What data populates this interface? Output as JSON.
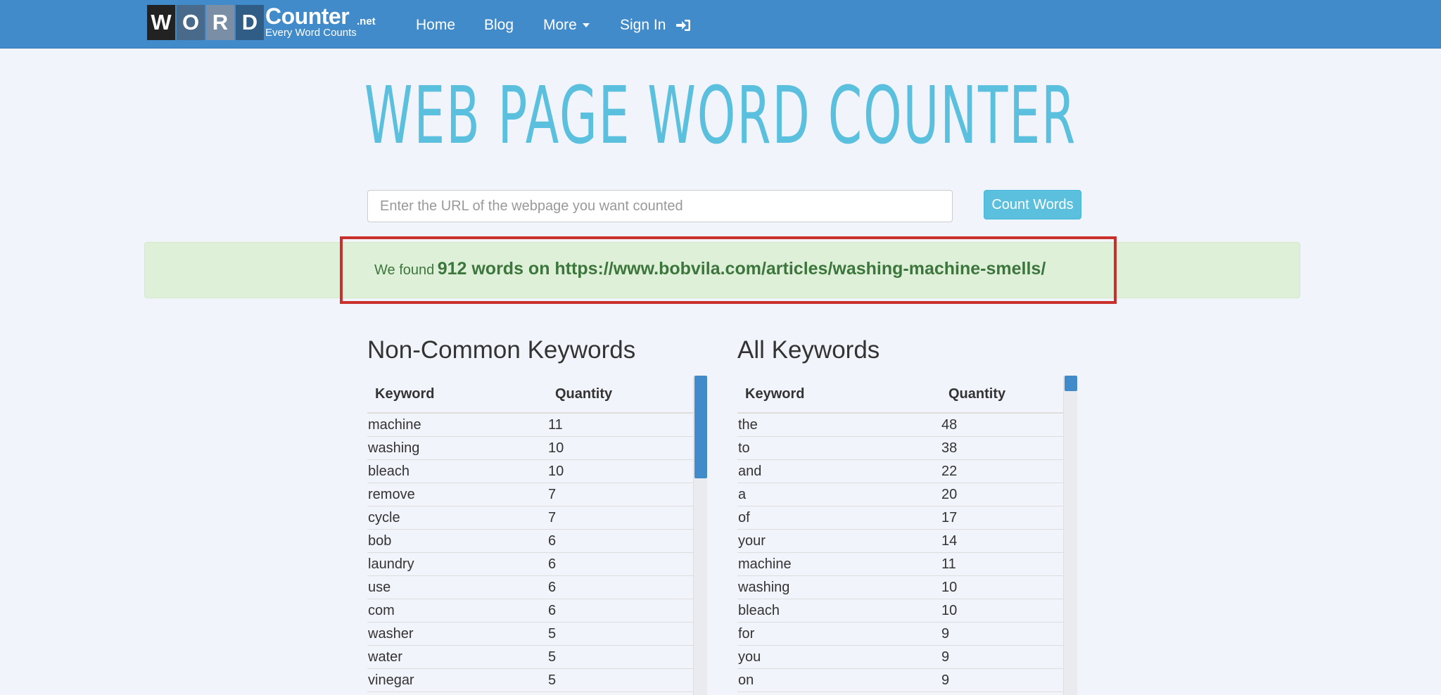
{
  "brand": {
    "letters": [
      "W",
      "O",
      "R",
      "D"
    ],
    "letter_colors": [
      "#222222",
      "#4a6a8c",
      "#7a8fa6",
      "#2f5d86"
    ],
    "name": "Counter",
    "suffix": ".net",
    "tagline": "Every Word Counts"
  },
  "nav": {
    "home": "Home",
    "blog": "Blog",
    "more": "More",
    "signin": "Sign In",
    "signin_icon": "sign-in-icon",
    "more_icon": "caret-down-icon"
  },
  "title": "WEB PAGE WORD COUNTER",
  "form": {
    "url_placeholder": "Enter the URL of the webpage you want counted",
    "url_value": "",
    "button_label": "Count Words"
  },
  "result": {
    "prefix": "We found",
    "word_count_text": "912 words on https://www.bobvila.com/articles/washing-machine-smells/"
  },
  "non_common": {
    "heading": "Non-Common Keywords",
    "col_keyword": "Keyword",
    "col_quantity": "Quantity",
    "rows": [
      {
        "keyword": "machine",
        "quantity": "11"
      },
      {
        "keyword": "washing",
        "quantity": "10"
      },
      {
        "keyword": "bleach",
        "quantity": "10"
      },
      {
        "keyword": "remove",
        "quantity": "7"
      },
      {
        "keyword": "cycle",
        "quantity": "7"
      },
      {
        "keyword": "bob",
        "quantity": "6"
      },
      {
        "keyword": "laundry",
        "quantity": "6"
      },
      {
        "keyword": "use",
        "quantity": "6"
      },
      {
        "keyword": "com",
        "quantity": "6"
      },
      {
        "keyword": "washer",
        "quantity": "5"
      },
      {
        "keyword": "water",
        "quantity": "5"
      },
      {
        "keyword": "vinegar",
        "quantity": "5"
      }
    ]
  },
  "all": {
    "heading": "All Keywords",
    "col_keyword": "Keyword",
    "col_quantity": "Quantity",
    "rows": [
      {
        "keyword": "the",
        "quantity": "48"
      },
      {
        "keyword": "to",
        "quantity": "38"
      },
      {
        "keyword": "and",
        "quantity": "22"
      },
      {
        "keyword": "a",
        "quantity": "20"
      },
      {
        "keyword": "of",
        "quantity": "17"
      },
      {
        "keyword": "your",
        "quantity": "14"
      },
      {
        "keyword": "machine",
        "quantity": "11"
      },
      {
        "keyword": "washing",
        "quantity": "10"
      },
      {
        "keyword": "bleach",
        "quantity": "10"
      },
      {
        "keyword": "for",
        "quantity": "9"
      },
      {
        "keyword": "you",
        "quantity": "9"
      },
      {
        "keyword": "on",
        "quantity": "9"
      }
    ]
  },
  "colors": {
    "navbar": "#428bca",
    "title": "#5bc0de",
    "button": "#5bc0de",
    "alert_bg": "#dff0d8",
    "alert_text": "#3c763d",
    "highlight_border": "#c9302c",
    "scroll_thumb": "#428bca"
  }
}
